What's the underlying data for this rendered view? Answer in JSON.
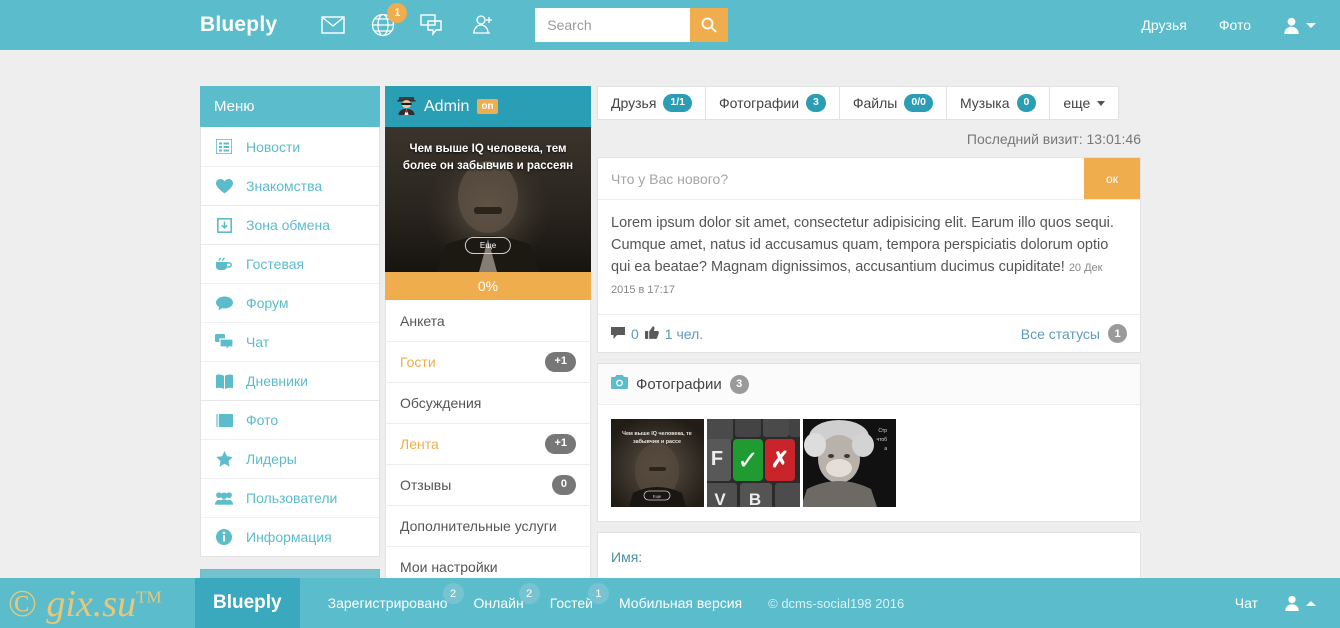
{
  "header": {
    "brand": "Blueply",
    "icons": [
      {
        "name": "mail-icon",
        "badge": null
      },
      {
        "name": "globe-icon",
        "badge": "1"
      },
      {
        "name": "chat-icon",
        "badge": null
      },
      {
        "name": "add-friend-icon",
        "badge": null
      }
    ],
    "search": {
      "placeholder": "Search",
      "value": "",
      "button_icon": "search-icon"
    },
    "links": [
      "Друзья",
      "Фото"
    ],
    "user_menu_icon": "user-icon"
  },
  "menu": {
    "title": "Меню",
    "items": [
      {
        "label": "Новости",
        "icon": "list-icon"
      },
      {
        "label": "Знакомства",
        "icon": "heart-icon"
      },
      {
        "label": "Зона обмена",
        "icon": "download-icon"
      },
      {
        "label": "Гостевая",
        "icon": "coffee-icon"
      },
      {
        "label": "Форум",
        "icon": "comment-icon"
      },
      {
        "label": "Чат",
        "icon": "chat-icon"
      },
      {
        "label": "Дневники",
        "icon": "book-icon"
      },
      {
        "label": "Фото",
        "icon": "folder-icon"
      },
      {
        "label": "Лидеры",
        "icon": "star-icon"
      },
      {
        "label": "Пользователи",
        "icon": "users-icon"
      },
      {
        "label": "Информация",
        "icon": "info-icon"
      }
    ]
  },
  "profile": {
    "name": "Admin",
    "online_badge": "on",
    "avatar_icon": "spy-avatar-icon",
    "quote": "Чем выше IQ человека, тем более он забывчив и рассеян",
    "more_button": "Еще",
    "progress": "0%",
    "rows": [
      {
        "label": "Анкета",
        "badge": null,
        "accent": false
      },
      {
        "label": "Гости",
        "badge": "+1",
        "accent": true
      },
      {
        "label": "Обсуждения",
        "badge": null,
        "accent": false
      },
      {
        "label": "Лента",
        "badge": "+1",
        "accent": true
      },
      {
        "label": "Отзывы",
        "badge": "0",
        "accent": false
      },
      {
        "label": "Дополнительные услуги",
        "badge": null,
        "accent": false
      },
      {
        "label": "Мои настройки",
        "badge": null,
        "accent": false
      }
    ]
  },
  "main": {
    "tabs": [
      {
        "label": "Друзья",
        "badge": "1/1"
      },
      {
        "label": "Фотографии",
        "badge": "3"
      },
      {
        "label": "Файлы",
        "badge": "0/0"
      },
      {
        "label": "Музыка",
        "badge": "0"
      },
      {
        "label": "еще",
        "badge": null
      }
    ],
    "last_visit": "Последний визит: 13:01:46",
    "status_form": {
      "placeholder": "Что у Вас нового?",
      "value": "",
      "ok_label": "ок"
    },
    "status_post": {
      "text": "Lorem ipsum dolor sit amet, consectetur adipisicing elit. Earum illo quos sequi. Cumque amet, natus id accusamus quam, tempora perspiciatis dolorum optio qui ea beatae? Magnam dignissimos, accusantium ducimus cupiditate!",
      "date": "20 Дек 2015 в 17:17",
      "comments_count": "0",
      "likes_text": "1 чел.",
      "comment_icon": "comment-icon",
      "like_icon": "thumbs-up-icon",
      "all_statuses_label": "Все статусы",
      "all_statuses_badge": "1"
    },
    "photos": {
      "title": "Фотографии",
      "icon": "camera-icon",
      "count": "3",
      "items": [
        {
          "name": "photo-quote-einstein",
          "caption": "Чем выше IQ человека, тем более он забывчив и рассеян"
        },
        {
          "name": "photo-keyboard-checkmark",
          "caption": ""
        },
        {
          "name": "photo-einstein-portrait",
          "caption": "Стр... чтоб... a..."
        }
      ]
    },
    "name_field": {
      "label": "Имя:"
    }
  },
  "footer": {
    "brand": "Blueply",
    "items": [
      {
        "label": "Зарегистрировано",
        "badge": "2"
      },
      {
        "label": "Онлайн",
        "badge": "2"
      },
      {
        "label": "Гостей",
        "badge": "1"
      },
      {
        "label": "Мобильная версия",
        "badge": null
      }
    ],
    "copyright": "© dcms-social198 2016",
    "chat_label": "Чат",
    "user_icon": "user-icon"
  },
  "watermark": {
    "text": "gix.su",
    "mark": "©",
    "tm": "TM"
  },
  "colors": {
    "teal": "#5bbccb",
    "teal_dark": "#2a9eb5",
    "orange": "#f0ad4e",
    "gray_pill": "#777777"
  }
}
